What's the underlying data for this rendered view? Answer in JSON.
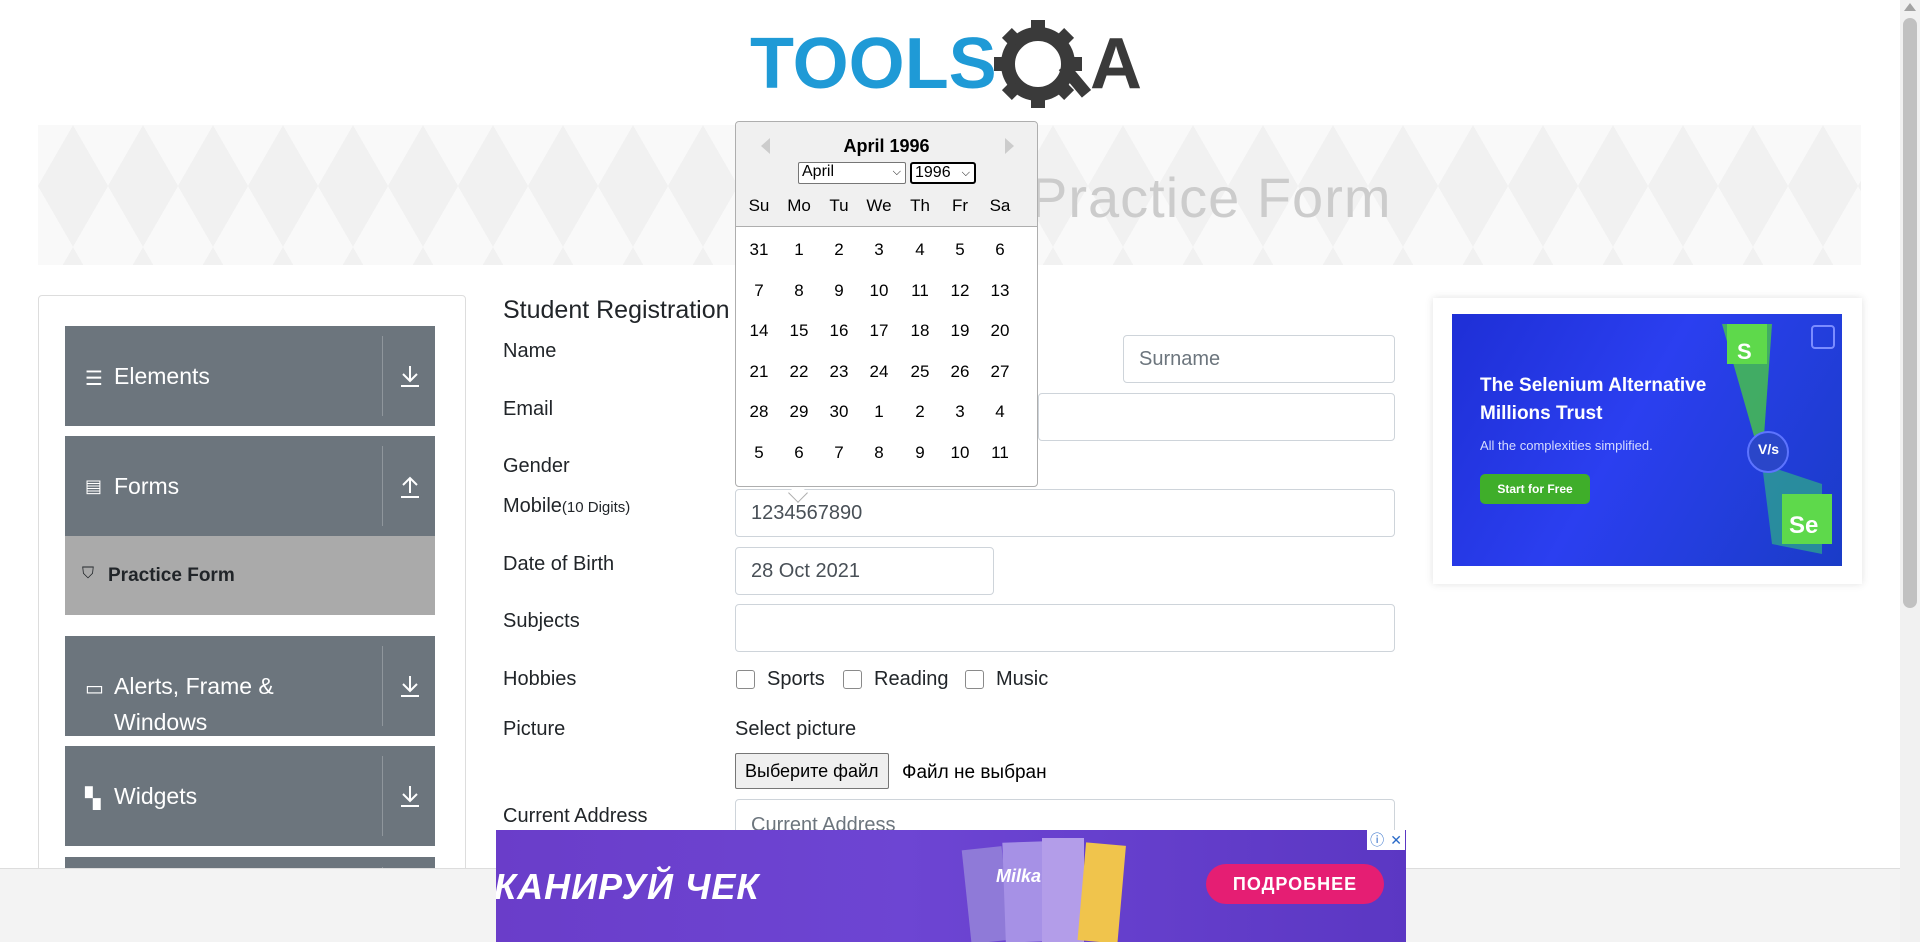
{
  "logo": {
    "text_tools": "TOOLS",
    "text_qa": "QA"
  },
  "banner": {
    "title": "Practice Form"
  },
  "sidebar": {
    "groups": [
      {
        "label": "Elements",
        "icon": "hamburger-icon",
        "arrow": "download-arrow-icon"
      },
      {
        "label": "Forms",
        "icon": "document-icon",
        "arrow": "upload-arrow-icon"
      },
      {
        "label": "Alerts, Frame & Windows",
        "icon": "window-icon",
        "arrow": "download-arrow-icon"
      },
      {
        "label": "Widgets",
        "icon": "widgets-icon",
        "arrow": "download-arrow-icon"
      }
    ],
    "active_item": {
      "label": "Practice Form",
      "icon": "html-icon"
    }
  },
  "form": {
    "title": "Student Registration Form",
    "labels": {
      "name": "Name",
      "email": "Email",
      "gender": "Gender",
      "mobile": "Mobile",
      "mobile_hint": "(10 Digits)",
      "dob": "Date of Birth",
      "subjects": "Subjects",
      "hobbies": "Hobbies",
      "picture": "Picture",
      "current_address": "Current Address"
    },
    "surname_placeholder": "Surname",
    "mobile_value": "1234567890",
    "dob_value": "28 Oct 2021",
    "subjects_value": "",
    "hobbies": [
      "Sports",
      "Reading",
      "Music"
    ],
    "picture_label": "Select picture",
    "file_button": "Выберите файл",
    "file_status": "Файл не выбран",
    "address_placeholder": "Current Address"
  },
  "calendar": {
    "title": "April 1996",
    "month_select": "April",
    "year_select": "1996",
    "weekdays": [
      "Su",
      "Mo",
      "Tu",
      "We",
      "Th",
      "Fr",
      "Sa"
    ],
    "weeks": [
      [
        "31",
        "1",
        "2",
        "3",
        "4",
        "5",
        "6"
      ],
      [
        "7",
        "8",
        "9",
        "10",
        "11",
        "12",
        "13"
      ],
      [
        "14",
        "15",
        "16",
        "17",
        "18",
        "19",
        "20"
      ],
      [
        "21",
        "22",
        "23",
        "24",
        "25",
        "26",
        "27"
      ],
      [
        "28",
        "29",
        "30",
        "1",
        "2",
        "3",
        "4"
      ],
      [
        "5",
        "6",
        "7",
        "8",
        "9",
        "10",
        "11"
      ]
    ]
  },
  "ad_right": {
    "title": "The Selenium Alternative Millions Trust",
    "subtitle": "All the complexities simplified.",
    "button": "Start for Free",
    "vs": "V/s",
    "badge_s": "S",
    "badge_se": "Se"
  },
  "ad_bottom": {
    "text": "КАНИРУЙ ЧЕК",
    "button": "ПОДРОБНЕЕ",
    "brand": "Milka"
  },
  "colors": {
    "sidebar_group": "#6c757d",
    "active_item": "#aaaaaa",
    "logo_blue": "#1f9ad6",
    "logo_dark": "#3a3a3a",
    "ad_blue": "#2b3ff0",
    "ad_green": "#3fae2a",
    "ad_bottom_purple": "#6a3dc9",
    "ad_bottom_pink": "#e51e73"
  }
}
